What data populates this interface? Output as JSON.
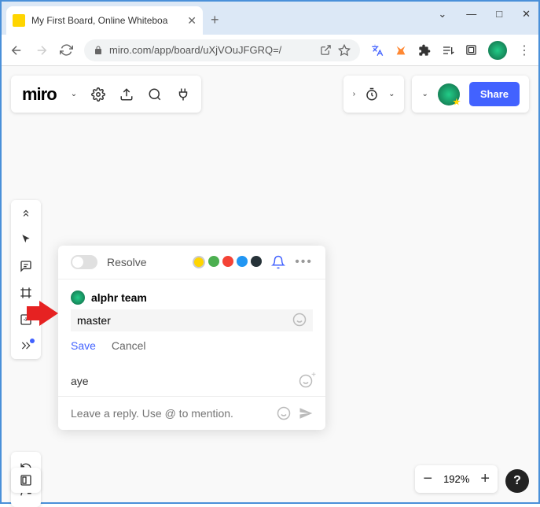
{
  "browser": {
    "tab_title": "My First Board, Online Whiteboa",
    "url": "miro.com/app/board/uXjVOuJFGRQ=/",
    "window_controls": {
      "min": "—",
      "max": "□",
      "close": "✕",
      "dropdown": "⌄"
    }
  },
  "miro": {
    "logo": "miro",
    "share_label": "Share"
  },
  "comment": {
    "resolve_label": "Resolve",
    "user_name": "alphr team",
    "edit_value": "master",
    "save_label": "Save",
    "cancel_label": "Cancel",
    "prev_message": "aye",
    "reply_placeholder": "Leave a reply. Use @ to mention."
  },
  "zoom": {
    "value": "192%"
  },
  "help": "?"
}
